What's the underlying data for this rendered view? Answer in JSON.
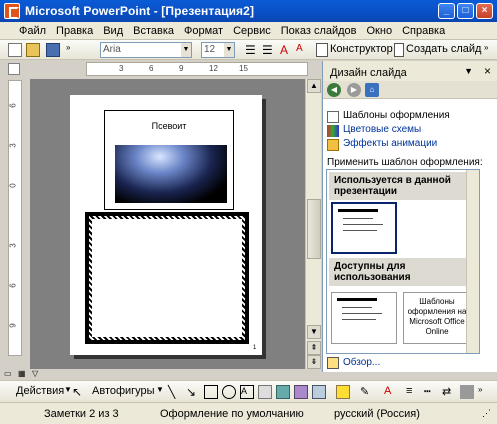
{
  "window": {
    "title": "Microsoft PowerPoint - [Презентация2]",
    "btn_min": "_",
    "btn_max": "□",
    "btn_close": "×"
  },
  "menu": [
    "Файл",
    "Правка",
    "Вид",
    "Вставка",
    "Формат",
    "Сервис",
    "Показ слайдов",
    "Окно",
    "Справка"
  ],
  "toolbar": {
    "font": "Aria",
    "size": "12",
    "design_label": "Конструктор",
    "new_slide_label": "Создать слайд"
  },
  "ruler": {
    "h": [
      "3",
      "6",
      "9",
      "12",
      "15"
    ],
    "v": [
      "6",
      "3",
      "0",
      "3",
      "6",
      "9"
    ]
  },
  "slide": {
    "title": "Псевоит"
  },
  "taskpane": {
    "title": "Дизайн слайда",
    "close": "×",
    "links": [
      "Шаблоны оформления",
      "Цветовые схемы",
      "Эффекты анимации"
    ],
    "apply_label": "Применить шаблон оформления:",
    "section_used": "Используется в данной презентации",
    "section_available": "Доступны для использования",
    "online_template": "Шаблоны оформления на Microsoft Office Online",
    "browse": "Обзор..."
  },
  "drawbar": {
    "draw_label": "Действия",
    "autoshapes_label": "Автофигуры"
  },
  "status": {
    "slide_info": "Заметки 2 из 3",
    "design": "Оформление по умолчанию",
    "language": "русский (Россия)"
  }
}
